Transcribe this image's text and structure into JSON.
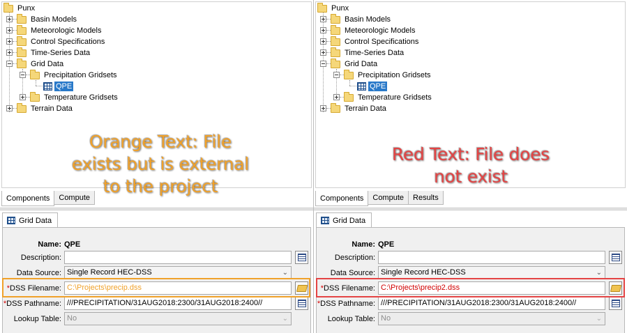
{
  "colors": {
    "orange": "#f0a12a",
    "red": "#e44444",
    "selection": "#2979c9",
    "required": "#d10000"
  },
  "panels": [
    {
      "tree": {
        "root": "Punx",
        "items": [
          "Basin Models",
          "Meteorologic Models",
          "Control Specifications",
          "Time-Series Data",
          "Grid Data",
          "Precipitation Gridsets",
          "QPE",
          "Temperature Gridsets",
          "Terrain Data"
        ]
      },
      "tabs": [
        "Components",
        "Compute"
      ],
      "editor": {
        "tab_label": "Grid Data",
        "name_label": "Name:",
        "name_value": "QPE",
        "description_label": "Description:",
        "description_value": "",
        "data_source_label": "Data Source:",
        "data_source_value": "Single Record HEC-DSS",
        "dss_filename_required": "*",
        "dss_filename_label": "DSS Filename:",
        "dss_filename_value": "C:\\Projects\\precip.dss",
        "dss_pathname_required": "*",
        "dss_pathname_label": "DSS Pathname:",
        "dss_pathname_value": "///PRECIPITATION/31AUG2018:2300/31AUG2018:2400//",
        "lookup_label": "Lookup Table:",
        "lookup_value": "No"
      },
      "annotation": {
        "line1": "Orange Text: File",
        "line2": "exists but is external",
        "line3": "to the project"
      }
    },
    {
      "tree": {
        "root": "Punx",
        "items": [
          "Basin Models",
          "Meteorologic Models",
          "Control Specifications",
          "Time-Series Data",
          "Grid Data",
          "Precipitation Gridsets",
          "QPE",
          "Temperature Gridsets",
          "Terrain Data"
        ]
      },
      "tabs": [
        "Components",
        "Compute",
        "Results"
      ],
      "editor": {
        "tab_label": "Grid Data",
        "name_label": "Name:",
        "name_value": "QPE",
        "description_label": "Description:",
        "description_value": "",
        "data_source_label": "Data Source:",
        "data_source_value": "Single Record HEC-DSS",
        "dss_filename_required": "*",
        "dss_filename_label": "DSS Filename:",
        "dss_filename_value": "C:\\Projects\\precip2.dss",
        "dss_pathname_required": "*",
        "dss_pathname_label": "DSS Pathname:",
        "dss_pathname_value": "///PRECIPITATION/31AUG2018:2300/31AUG2018:2400//",
        "lookup_label": "Lookup Table:",
        "lookup_value": "No"
      },
      "annotation": {
        "line1": "Red Text: File does",
        "line2": "not exist"
      }
    }
  ]
}
